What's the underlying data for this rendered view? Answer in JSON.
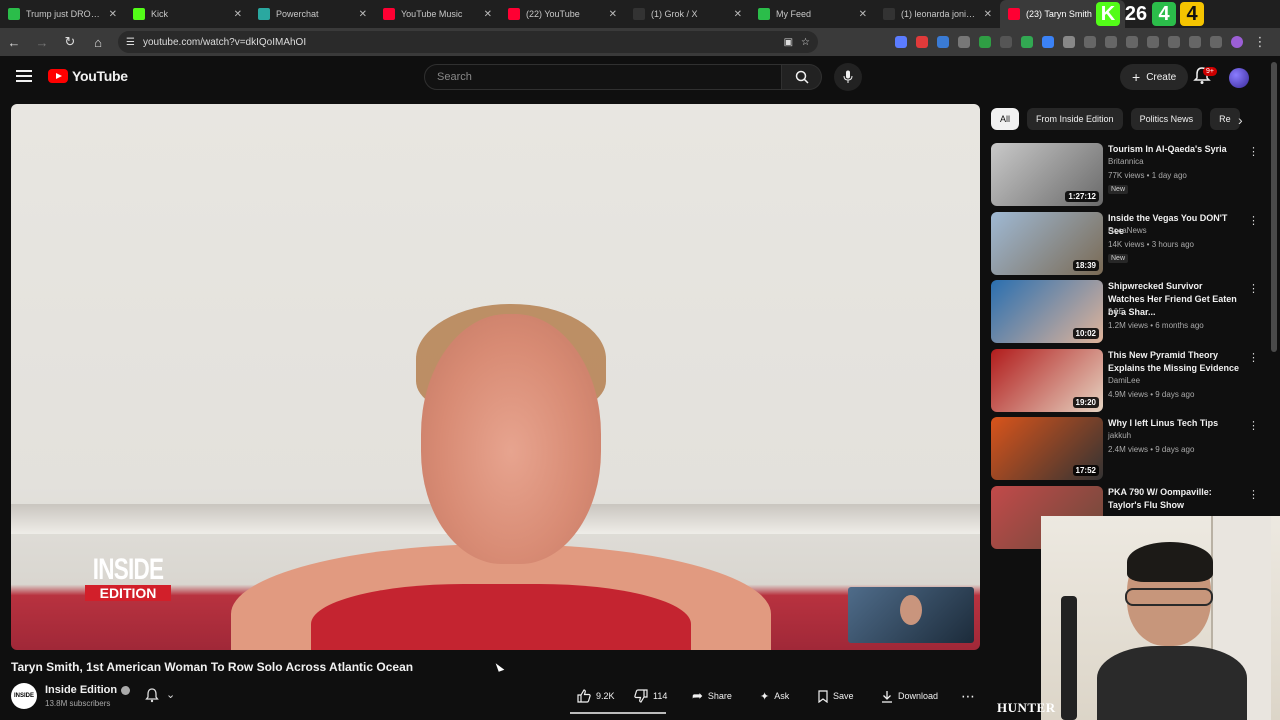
{
  "tabs": [
    {
      "title": "Trump just DROPP",
      "color": "#2bbd4a"
    },
    {
      "title": "Kick",
      "color": "#53fc18"
    },
    {
      "title": "Powerchat",
      "color": "#2aa8a0"
    },
    {
      "title": "YouTube Music",
      "color": "#ff0033"
    },
    {
      "title": "(22) YouTube",
      "color": "#ff0033"
    },
    {
      "title": "(1) Grok / X",
      "color": "#333333"
    },
    {
      "title": "My Feed",
      "color": "#2bbd4a"
    },
    {
      "title": "(1) leonarda jonie - S",
      "color": "#333333"
    },
    {
      "title": "(23) Taryn Smith",
      "color": "#ff0033",
      "active": true
    }
  ],
  "tab_extras": [
    "K",
    "26",
    "4",
    "4"
  ],
  "address": {
    "url": "youtube.com/watch?v=dkIQoIMAhOI"
  },
  "youtube": {
    "logo": "YouTube",
    "search_placeholder": "Search",
    "create_label": "Create",
    "notification_badge": "9+"
  },
  "video": {
    "overlay_logo_top": "INSIDE",
    "overlay_logo_bottom": "EDITION",
    "title": "Taryn Smith, 1st American Woman To Row Solo Across Atlantic Ocean",
    "channel": "Inside Edition",
    "channel_avatar_text": "INSIDE",
    "subscribers": "13.8M subscribers",
    "likes": "9.2K",
    "dislikes": "114",
    "share": "Share",
    "ask": "Ask",
    "save": "Save",
    "download": "Download"
  },
  "chips": [
    "All",
    "From Inside Edition",
    "Politics News",
    "Re"
  ],
  "recommendations": [
    {
      "title": "Tourism In Al-Qaeda's Syria",
      "channel": "Britannica",
      "meta": "77K views • 1 day ago",
      "duration": "1:27:12",
      "new": "New",
      "thumb": "linear-gradient(135deg,#c9c9c9,#6a6a6a)"
    },
    {
      "title": "Inside the Vegas You DON'T See",
      "channel": "RocaNews",
      "meta": "14K views • 3 hours ago",
      "duration": "18:39",
      "new": "New",
      "thumb": "linear-gradient(135deg,#9fb9d4,#7a6a54)"
    },
    {
      "title": "Shipwrecked Survivor Watches Her Friend Get Eaten by a Shar...",
      "channel": "A&E",
      "meta": "1.2M views • 6 months ago",
      "duration": "10:02",
      "thumb": "linear-gradient(135deg,#2a6fb0,#e0b49a)"
    },
    {
      "title": "This New Pyramid Theory Explains the Missing Evidence",
      "channel": "DamiLee",
      "meta": "4.9M views • 9 days ago",
      "duration": "19:20",
      "thumb": "linear-gradient(135deg,#b11c1c,#e6d4c2)"
    },
    {
      "title": "Why I left Linus Tech Tips",
      "channel": "jakkuh",
      "meta": "2.4M views • 9 days ago",
      "duration": "17:52",
      "thumb": "linear-gradient(135deg,#d9541b,#333)"
    },
    {
      "title": "PKA 790 W/ Oompaville: Taylor's Flu Show",
      "channel": "",
      "meta": "",
      "duration": "",
      "thumb": "linear-gradient(135deg,#c24a4a,#6a4a3a)"
    }
  ],
  "bottom_overlay_text": "HUNTER"
}
